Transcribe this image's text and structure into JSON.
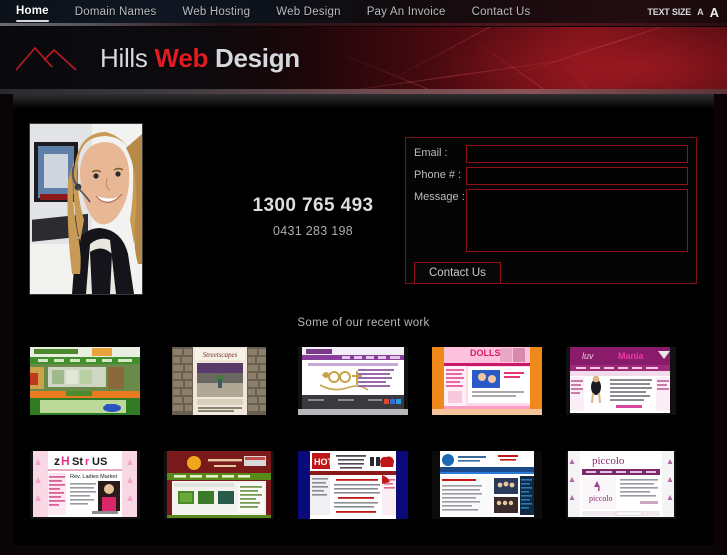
{
  "nav": {
    "items": [
      {
        "label": "Home",
        "active": true
      },
      {
        "label": "Domain Names",
        "active": false
      },
      {
        "label": "Web Hosting",
        "active": false
      },
      {
        "label": "Web Design",
        "active": false
      },
      {
        "label": "Pay An Invoice",
        "active": false
      },
      {
        "label": "Contact Us",
        "active": false
      }
    ],
    "text_size_label": "TEXT SIZE",
    "text_size_small": "A",
    "text_size_large": "A"
  },
  "brand": {
    "word1": "Hills",
    "word2": "Web",
    "word3": "Design",
    "accent_color": "#e01b22",
    "text_color": "#d4d7db",
    "logo_icon": "hills-mountain-icon"
  },
  "hero": {
    "photo_alt": "smiling-woman-with-headset",
    "phone_primary": "1300 765 493",
    "phone_secondary": "0431 283 198"
  },
  "contact_form": {
    "email_label": "Email :",
    "email_value": "",
    "email_placeholder": "",
    "phone_label": "Phone # :",
    "phone_value": "",
    "phone_placeholder": "",
    "message_label": "Message :",
    "message_value": "",
    "message_placeholder": "",
    "submit_label": "Contact Us",
    "border_color": "#8e1119"
  },
  "portfolio": {
    "heading": "Some of our recent work",
    "rows": [
      [
        {
          "name": "green-garden-nursery-site"
        },
        {
          "name": "stone-walled-streetscapes-site"
        },
        {
          "name": "purple-jewellery-site"
        },
        {
          "name": "orange-pink-kids-dolls-site"
        },
        {
          "name": "magenta-dance-studio-site"
        }
      ],
      [
        {
          "name": "pink-zoha-stars-us-site"
        },
        {
          "name": "dark-red-green-community-site"
        },
        {
          "name": "blue-bordered-club-site"
        },
        {
          "name": "white-blue-news-site"
        },
        {
          "name": "purple-piccolo-site"
        }
      ]
    ]
  }
}
